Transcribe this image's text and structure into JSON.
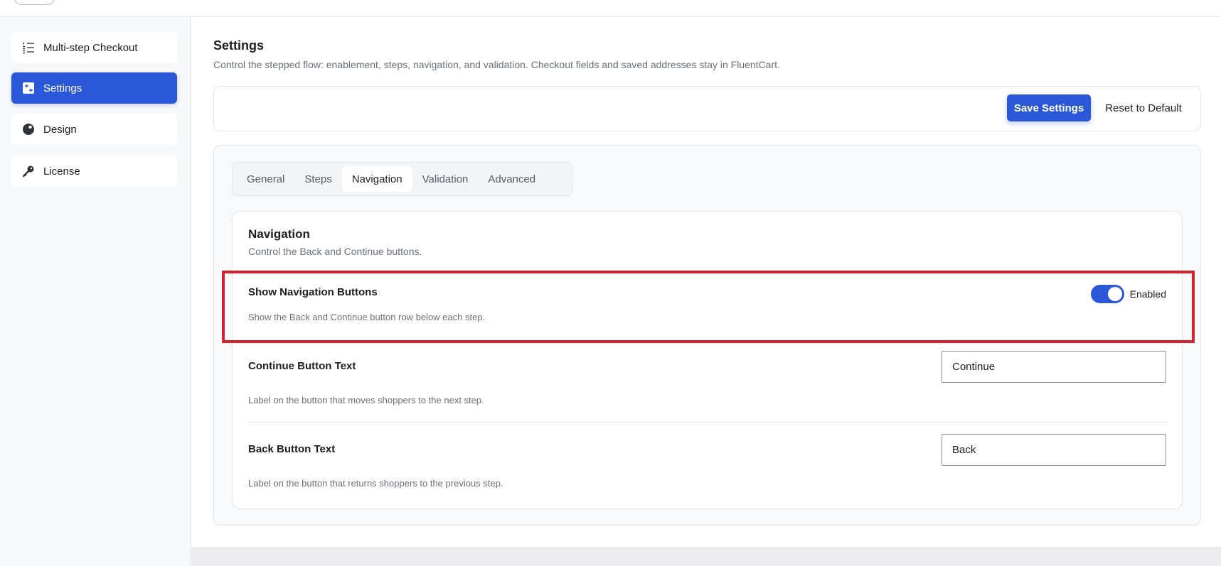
{
  "sidebar": {
    "items": [
      {
        "label": "Multi-step Checkout",
        "icon": "list-numbered-icon",
        "active": false
      },
      {
        "label": "Settings",
        "icon": "settings-panel-icon",
        "active": true
      },
      {
        "label": "Design",
        "icon": "palette-icon",
        "active": false
      },
      {
        "label": "License",
        "icon": "key-icon",
        "active": false
      }
    ]
  },
  "header": {
    "title": "Settings",
    "subtitle": "Control the stepped flow: enablement, steps, navigation, and validation. Checkout fields and saved addresses stay in FluentCart."
  },
  "actions": {
    "save_label": "Save Settings",
    "reset_label": "Reset to Default"
  },
  "tabs": [
    {
      "label": "General",
      "active": false
    },
    {
      "label": "Steps",
      "active": false
    },
    {
      "label": "Navigation",
      "active": true
    },
    {
      "label": "Validation",
      "active": false
    },
    {
      "label": "Advanced",
      "active": false
    }
  ],
  "navigation_card": {
    "title": "Navigation",
    "subtitle": "Control the Back and Continue buttons.",
    "show_buttons": {
      "label": "Show Navigation Buttons",
      "help": "Show the Back and Continue button row below each step.",
      "toggle_state": "Enabled",
      "enabled": true
    },
    "continue_text": {
      "label": "Continue Button Text",
      "help": "Label on the button that moves shoppers to the next step.",
      "value": "Continue"
    },
    "back_text": {
      "label": "Back Button Text",
      "help": "Label on the button that returns shoppers to the previous step.",
      "value": "Back"
    }
  },
  "colors": {
    "accent": "#2b58d9",
    "highlight": "#d9202c"
  }
}
